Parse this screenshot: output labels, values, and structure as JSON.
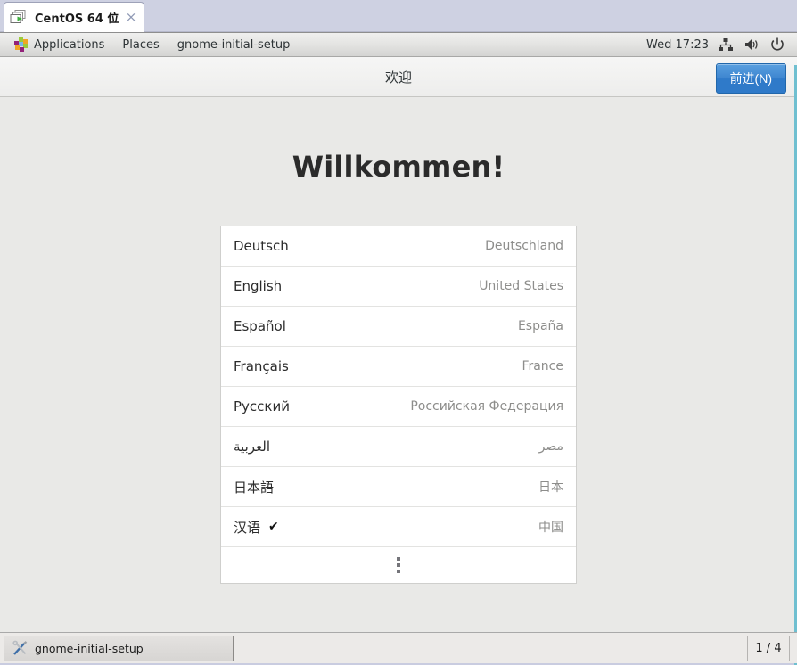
{
  "vm_tab": {
    "title": "CentOS 64 位",
    "icon": "virtual-machine-icon",
    "close_label": "×"
  },
  "panel": {
    "applications_label": "Applications",
    "applications_icon": "centos-apps-logo-icon",
    "places_label": "Places",
    "window_label": "gnome-initial-setup",
    "clock": "Wed 17:23",
    "tray": [
      {
        "name": "network-icon"
      },
      {
        "name": "volume-icon"
      },
      {
        "name": "power-icon"
      }
    ]
  },
  "headerbar": {
    "title": "欢迎",
    "next_label": "前进(N)",
    "next_color": "#2f7ac9"
  },
  "welcome": {
    "heading": "Willkommen!"
  },
  "languages": [
    {
      "name": "Deutsch",
      "region": "Deutschland",
      "selected": false
    },
    {
      "name": "English",
      "region": "United States",
      "selected": false
    },
    {
      "name": "Español",
      "region": "España",
      "selected": false
    },
    {
      "name": "Français",
      "region": "France",
      "selected": false
    },
    {
      "name": "Русский",
      "region": "Российская Федерация",
      "selected": false
    },
    {
      "name": "العربية",
      "region": "مصر",
      "selected": false
    },
    {
      "name": "日本語",
      "region": "日本",
      "selected": false
    },
    {
      "name": "汉语",
      "region": "中国",
      "selected": true
    }
  ],
  "selected_mark": "✔",
  "more_row": {
    "icon": "more-vertical-icon"
  },
  "taskbar": {
    "window_button_label": "gnome-initial-setup",
    "window_button_icon": "setup-tools-icon",
    "workspace": "1 / 4"
  }
}
